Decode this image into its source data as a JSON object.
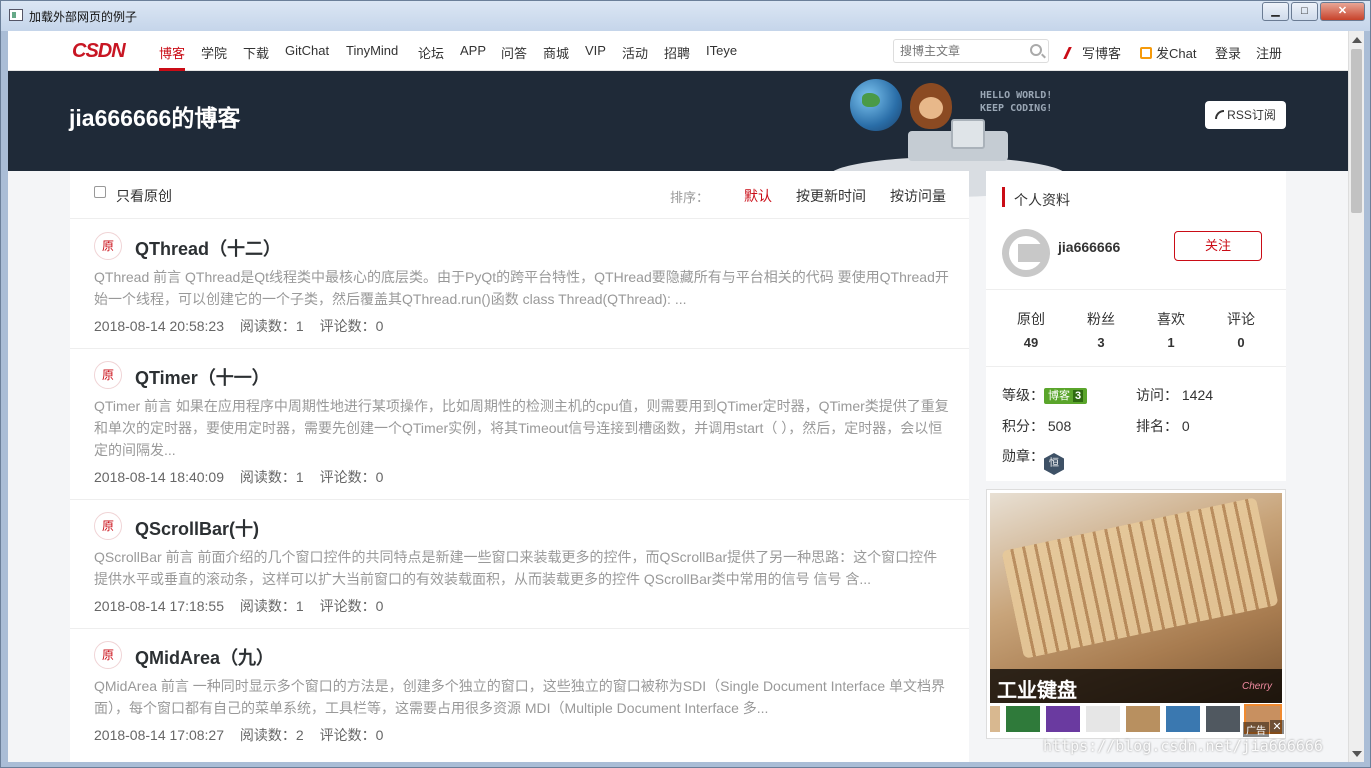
{
  "window": {
    "title": "加载外部网页的例子",
    "min_label": "▁",
    "max_label": "□",
    "close_label": "✕"
  },
  "nav": {
    "logo_c": "CSDN",
    "items": [
      "博客",
      "学院",
      "下载",
      "GitChat",
      "TinyMind",
      "论坛",
      "APP",
      "问答",
      "商城",
      "VIP",
      "活动",
      "招聘",
      "ITeye"
    ],
    "search_placeholder": "搜博主文章",
    "write_blog": "写博客",
    "post_chat": "发Chat",
    "login": "登录",
    "register": "注册"
  },
  "banner": {
    "blog_title": "jia666666的博客",
    "hello_line1": "HELLO WORLD!",
    "hello_line2": "KEEP CODING!",
    "rss_label": "RSS订阅"
  },
  "filter": {
    "original_only": "只看原创",
    "sort_label": "排序：",
    "sort_default": "默认",
    "sort_updated": "按更新时间",
    "sort_views": "按访问量"
  },
  "articles": [
    {
      "badge": "原",
      "title": "QThread（十二）",
      "desc": "QThread 前言 QThread是Qt线程类中最核心的底层类。由于PyQt的跨平台特性，QTHread要隐藏所有与平台相关的代码 要使用QThread开始一个线程，可以创建它的一个子类，然后覆盖其QThread.run()函数 class Thread(QThread): ...",
      "date": "2018-08-14 20:58:23",
      "reads": "阅读数：1",
      "comments": "评论数：0"
    },
    {
      "badge": "原",
      "title": "QTimer（十一）",
      "desc": "QTimer 前言 如果在应用程序中周期性地进行某项操作，比如周期性的检测主机的cpu值，则需要用到QTimer定时器，QTimer类提供了重复和单次的定时器，要使用定时器，需要先创建一个QTimer实例，将其Timeout信号连接到槽函数，并调用start（ ），然后，定时器，会以恒定的间隔发...",
      "date": "2018-08-14 18:40:09",
      "reads": "阅读数：1",
      "comments": "评论数：0"
    },
    {
      "badge": "原",
      "title": "QScrollBar(十)",
      "desc": "QScrollBar 前言 前面介绍的几个窗口控件的共同特点是新建一些窗口来装载更多的控件，而QScrollBar提供了另一种思路：这个窗口控件提供水平或垂直的滚动条，这样可以扩大当前窗口的有效装载面积，从而装载更多的控件 QScrollBar类中常用的信号 信号 含...",
      "date": "2018-08-14 17:18:55",
      "reads": "阅读数：1",
      "comments": "评论数：0"
    },
    {
      "badge": "原",
      "title": "QMidArea（九）",
      "desc": "QMidArea 前言 一种同时显示多个窗口的方法是，创建多个独立的窗口，这些独立的窗口被称为SDI（Single Document Interface 单文档界面），每个窗口都有自己的菜单系统，工具栏等，这需要占用很多资源 MDI（Multiple Document Interface 多...",
      "date": "2018-08-14 17:08:27",
      "reads": "阅读数：2",
      "comments": "评论数：0"
    }
  ],
  "profile": {
    "section_title": "个人资料",
    "name": "jia666666",
    "follow": "关注",
    "stats": [
      {
        "label": "原创",
        "value": "49"
      },
      {
        "label": "粉丝",
        "value": "3"
      },
      {
        "label": "喜欢",
        "value": "1"
      },
      {
        "label": "评论",
        "value": "0"
      }
    ],
    "level_label": "等级：",
    "level_badge": "博客",
    "level_num": "3",
    "visits_label": "访问：",
    "visits": "1424",
    "points_label": "积分：",
    "points": "508",
    "rank_label": "排名：",
    "rank": "0",
    "medal_label": "勋章：",
    "medal": "恒"
  },
  "ad": {
    "caption": "工业键盘",
    "signature": "Cherry",
    "tag": "广告",
    "close": "✕"
  },
  "watermark": "https://blog.csdn.net/jia666666",
  "colors": {
    "accent": "#ca0c16",
    "banner": "#1f2a38",
    "level_badge": "#5aa52b"
  }
}
